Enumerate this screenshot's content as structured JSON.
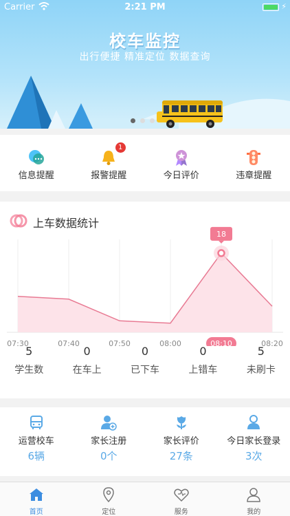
{
  "status_bar": {
    "carrier": "Carrier",
    "time": "2:21 PM"
  },
  "banner": {
    "title": "校车监控",
    "subtitle": "出行便捷 精准定位 数据查询",
    "slide_count": 3,
    "active_slide": 2
  },
  "quick_menu": [
    {
      "label": "信息提醒",
      "icon": "message-bubble-icon",
      "badge": ""
    },
    {
      "label": "报警提醒",
      "icon": "bell-icon",
      "badge": "1"
    },
    {
      "label": "今日评价",
      "icon": "ribbon-star-icon",
      "badge": ""
    },
    {
      "label": "违章提醒",
      "icon": "traffic-light-icon",
      "badge": ""
    }
  ],
  "chart_section": {
    "title": "上车数据统计"
  },
  "chart_data": {
    "type": "area",
    "x": [
      "07:30",
      "07:40",
      "07:50",
      "08:00",
      "08:10",
      "08:20"
    ],
    "values": [
      7,
      6.3,
      0.8,
      0.2,
      18,
      4.5
    ],
    "highlight_index": 4,
    "highlight_label": "18",
    "ylim": [
      -3,
      22
    ],
    "colors": {
      "line": "#e87a93",
      "fill": "#fde3e9",
      "highlight": "#f27b93"
    }
  },
  "stats": [
    {
      "value": "5",
      "label": "学生数"
    },
    {
      "value": "0",
      "label": "在车上"
    },
    {
      "value": "0",
      "label": "已下车"
    },
    {
      "value": "0",
      "label": "上错车"
    },
    {
      "value": "5",
      "label": "未刷卡"
    }
  ],
  "summary_menu": [
    {
      "label": "运营校车",
      "value": "6辆",
      "icon": "bus-icon"
    },
    {
      "label": "家长注册",
      "value": "0个",
      "icon": "user-add-icon"
    },
    {
      "label": "家长评价",
      "value": "27条",
      "icon": "tulip-icon"
    },
    {
      "label": "今日家长登录",
      "value": "3次",
      "icon": "person-login-icon"
    }
  ],
  "tab_bar": [
    {
      "label": "首页",
      "icon": "home-icon",
      "active": true
    },
    {
      "label": "定位",
      "icon": "location-pin-icon",
      "active": false
    },
    {
      "label": "服务",
      "icon": "heart-outline-icon",
      "active": false
    },
    {
      "label": "我的",
      "icon": "profile-icon",
      "active": false
    }
  ],
  "accent_color": "#5aa9e6"
}
